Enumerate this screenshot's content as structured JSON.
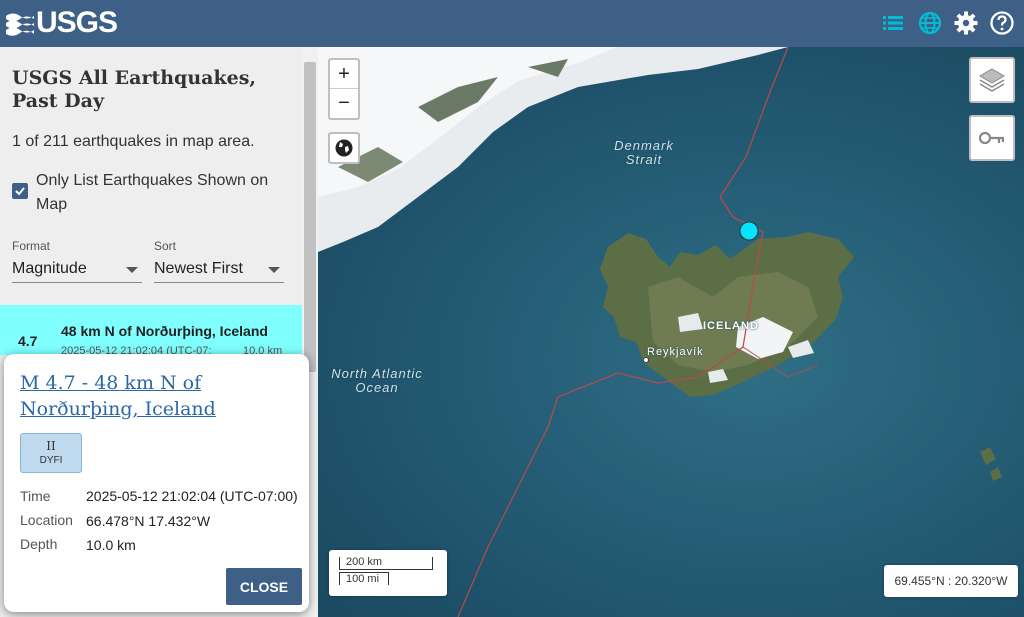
{
  "header": {
    "logo_text": "USGS",
    "icons": [
      "list-icon",
      "globe-icon",
      "gear-icon",
      "help-icon"
    ],
    "colors": {
      "bar": "#3e5f86",
      "accent": "#00bcd4"
    }
  },
  "sidebar": {
    "feed_title": "USGS All Earthquakes, Past Day",
    "count_text": "1 of 211 earthquakes in map area.",
    "only_list_label": "Only List Earthquakes Shown on Map",
    "only_list_checked": true,
    "format_label": "Format",
    "format_value": "Magnitude",
    "sort_label": "Sort",
    "sort_value": "Newest First",
    "list": [
      {
        "mag": "4.7",
        "place": "48 km N of Norðurþing, Iceland",
        "time": "2025-05-12 21:02:04 (UTC-07:",
        "depth": "10.0 km"
      }
    ]
  },
  "map": {
    "zoom_in": "+",
    "zoom_out": "−",
    "labels": {
      "denmark_strait": "Denmark\nStrait",
      "iceland": "ICELAND",
      "reykjavik": "Reykjavík",
      "north_atlantic": "North Atlantic\nOcean"
    },
    "scale_km": "200 km",
    "scale_mi": "100 mi",
    "cursor_coords": "69.455°N : 20.320°W",
    "marker_color": "#00e5ff"
  },
  "popup": {
    "title": "M 4.7 - 48 km N of Norðurþing, Iceland",
    "dyfi_intensity": "II",
    "dyfi_label": "DYFI",
    "time_label": "Time",
    "time_value": "2025-05-12 21:02:04 (UTC-07:00)",
    "location_label": "Location",
    "location_value": "66.478°N 17.432°W",
    "depth_label": "Depth",
    "depth_value": "10.0 km",
    "close_label": "CLOSE"
  }
}
